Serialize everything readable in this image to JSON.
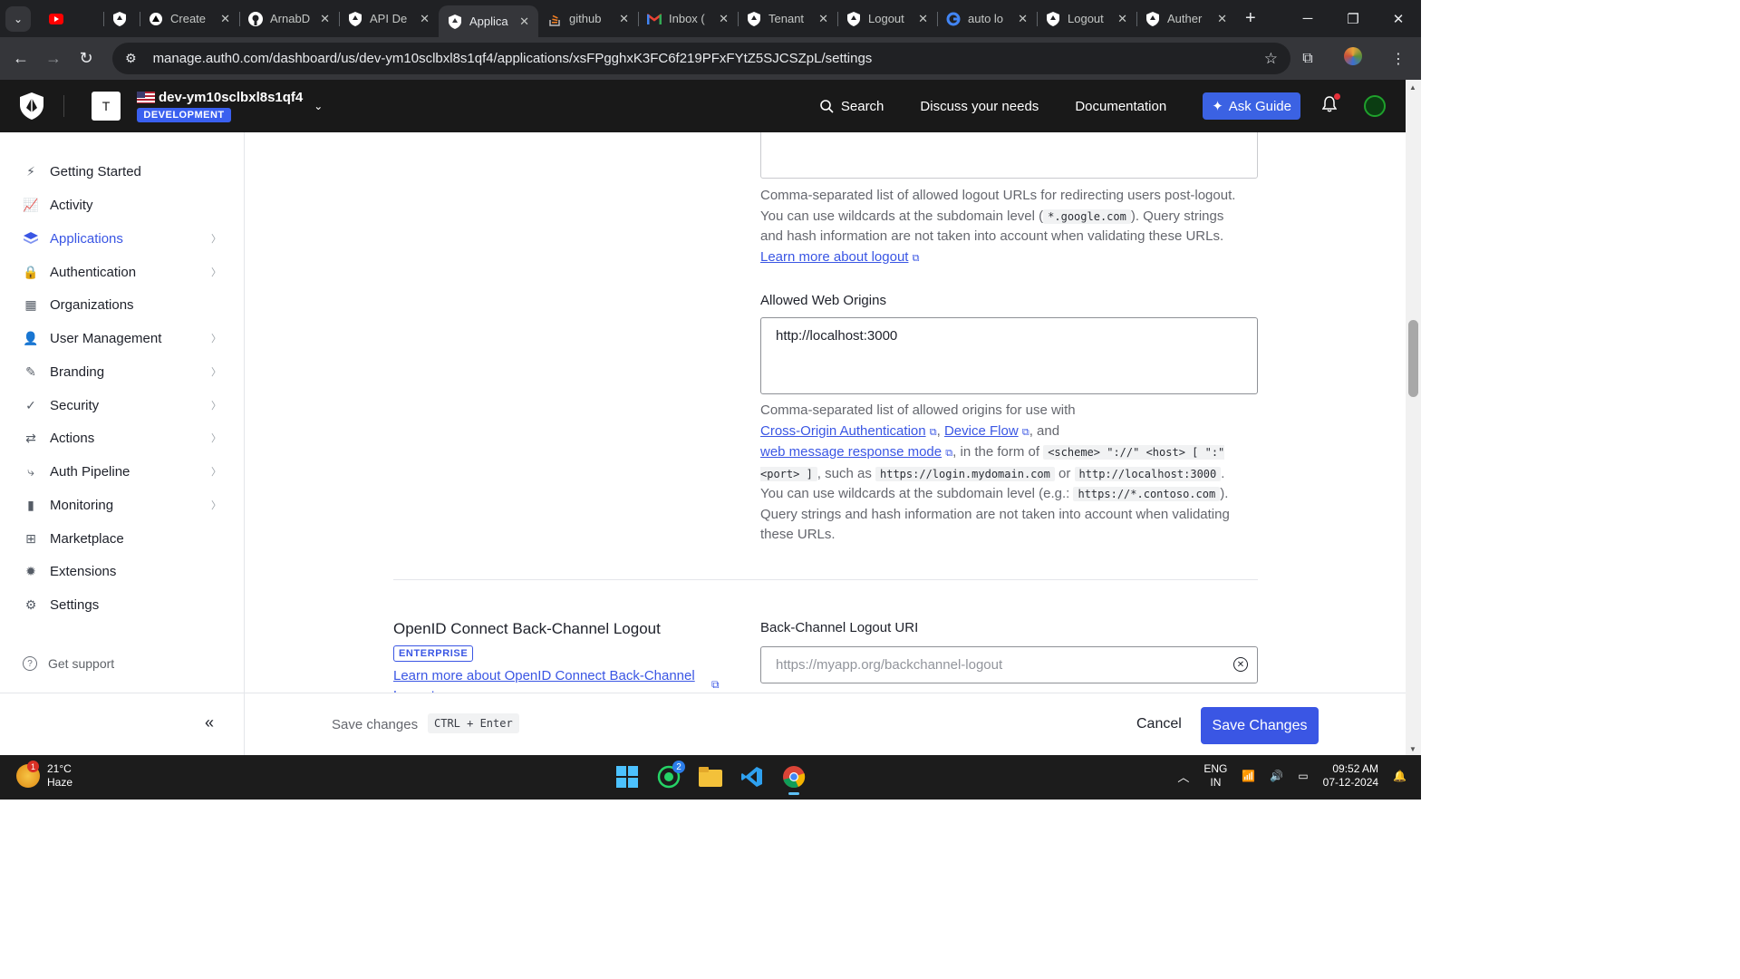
{
  "browser": {
    "tabs": [
      {
        "title": "Create",
        "icon": "vercel-icon"
      },
      {
        "title": "ArnabD",
        "icon": "github-icon"
      },
      {
        "title": "API De",
        "icon": "auth0-shield-icon"
      },
      {
        "title": "Applica",
        "icon": "auth0-shield-icon",
        "active": true
      },
      {
        "title": "github",
        "icon": "stackoverflow-icon"
      },
      {
        "title": "Inbox (",
        "icon": "gmail-icon"
      },
      {
        "title": "Tenant",
        "icon": "auth0-shield-icon"
      },
      {
        "title": "Logout",
        "icon": "auth0-shield-icon"
      },
      {
        "title": "auto lo",
        "icon": "google-icon"
      },
      {
        "title": "Logout",
        "icon": "auth0-shield-icon"
      },
      {
        "title": "Auther",
        "icon": "auth0-shield-icon"
      }
    ],
    "url": "manage.auth0.com/dashboard/us/dev-ym10sclbxl8s1qf4/applications/xsFPgghxK3FC6f219PFxFYtZ5SJCSZpL/settings"
  },
  "header": {
    "tenant_initial": "T",
    "tenant_name": "dev-ym10sclbxl8s1qf4",
    "environment_badge": "DEVELOPMENT",
    "search_label": "Search",
    "discuss_label": "Discuss your needs",
    "docs_label": "Documentation",
    "ask_guide_label": "Ask Guide"
  },
  "sidebar": {
    "items": [
      {
        "label": "Getting Started",
        "icon": "bolt-icon",
        "chevron": false
      },
      {
        "label": "Activity",
        "icon": "activity-chart-icon",
        "chevron": false
      },
      {
        "label": "Applications",
        "icon": "layers-icon",
        "chevron": true,
        "active": true
      },
      {
        "label": "Authentication",
        "icon": "lock-icon",
        "chevron": true
      },
      {
        "label": "Organizations",
        "icon": "building-icon",
        "chevron": false
      },
      {
        "label": "User Management",
        "icon": "users-icon",
        "chevron": true
      },
      {
        "label": "Branding",
        "icon": "brush-icon",
        "chevron": true
      },
      {
        "label": "Security",
        "icon": "shield-check-icon",
        "chevron": true
      },
      {
        "label": "Actions",
        "icon": "flow-icon",
        "chevron": true
      },
      {
        "label": "Auth Pipeline",
        "icon": "pipeline-icon",
        "chevron": true
      },
      {
        "label": "Monitoring",
        "icon": "bar-chart-icon",
        "chevron": true
      },
      {
        "label": "Marketplace",
        "icon": "grid-plus-icon",
        "chevron": false
      },
      {
        "label": "Extensions",
        "icon": "puzzle-icon",
        "chevron": false
      },
      {
        "label": "Settings",
        "icon": "gear-icon",
        "chevron": false
      }
    ],
    "get_support": "Get support"
  },
  "main": {
    "logout_help": {
      "t1": "Comma-separated list of allowed logout URLs for redirecting users post-logout. You can use wildcards at the subdomain level (",
      "code1": "*.google.com",
      "t2": "). Query strings and hash information are not taken into account when validating these URLs.",
      "link": "Learn more about logout"
    },
    "web_origins": {
      "label": "Allowed Web Origins",
      "value": "http://localhost:3000",
      "help": {
        "t1": "Comma-separated list of allowed origins for use with ",
        "link1": "Cross-Origin Authentication",
        "sep1": ", ",
        "link2": "Device Flow",
        "sep2": ", and ",
        "link3": "web message response mode",
        "t2": ", in the form of ",
        "code1": "<scheme> \"://\" <host> [ \":\" <port> ]",
        "t3": ", such as ",
        "code2": "https://login.mydomain.com",
        "t4": " or ",
        "code3": "http://localhost:3000",
        "t5": ". You can use wildcards at the subdomain level (e.g.: ",
        "code4": "https://*.contoso.com",
        "t6": "). Query strings and hash information are not taken into account when validating these URLs."
      }
    },
    "backchannel": {
      "section_title": "OpenID Connect Back-Channel Logout",
      "badge": "ENTERPRISE",
      "link": "Learn more about OpenID Connect Back-Channel Logout",
      "field_label": "Back-Channel Logout URI",
      "placeholder": "https://myapp.org/backchannel-logout"
    }
  },
  "footer": {
    "save_hint": "Save changes",
    "shortcut": "CTRL + Enter",
    "cancel_label": "Cancel",
    "save_label": "Save Changes"
  },
  "taskbar": {
    "weather_temp": "21°C",
    "weather_desc": "Haze",
    "weather_badge": "1",
    "whatsapp_badge": "2",
    "lang_line1": "ENG",
    "lang_line2": "IN",
    "time": "09:52 AM",
    "date": "07-12-2024"
  }
}
